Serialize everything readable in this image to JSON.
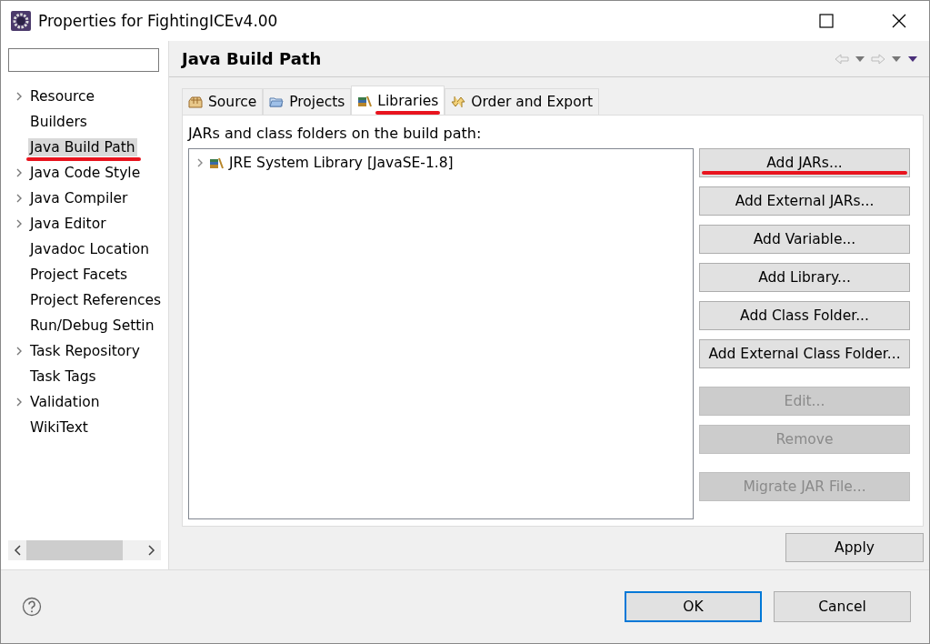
{
  "window": {
    "title": "Properties for FightingICEv4.00"
  },
  "sidebar": {
    "items": [
      {
        "label": "Resource",
        "expandable": true,
        "selected": false,
        "annotated": false
      },
      {
        "label": "Builders",
        "expandable": false,
        "selected": false,
        "annotated": false
      },
      {
        "label": "Java Build Path",
        "expandable": false,
        "selected": true,
        "annotated": true
      },
      {
        "label": "Java Code Style",
        "expandable": true,
        "selected": false,
        "annotated": false
      },
      {
        "label": "Java Compiler",
        "expandable": true,
        "selected": false,
        "annotated": false
      },
      {
        "label": "Java Editor",
        "expandable": true,
        "selected": false,
        "annotated": false
      },
      {
        "label": "Javadoc Location",
        "expandable": false,
        "selected": false,
        "annotated": false
      },
      {
        "label": "Project Facets",
        "expandable": false,
        "selected": false,
        "annotated": false
      },
      {
        "label": "Project References",
        "expandable": false,
        "selected": false,
        "annotated": false
      },
      {
        "label": "Run/Debug Settin",
        "expandable": false,
        "selected": false,
        "annotated": false
      },
      {
        "label": "Task Repository",
        "expandable": true,
        "selected": false,
        "annotated": false
      },
      {
        "label": "Task Tags",
        "expandable": false,
        "selected": false,
        "annotated": false
      },
      {
        "label": "Validation",
        "expandable": true,
        "selected": false,
        "annotated": false
      },
      {
        "label": "WikiText",
        "expandable": false,
        "selected": false,
        "annotated": false
      }
    ]
  },
  "page": {
    "title": "Java Build Path",
    "tabs": [
      {
        "label": "Source",
        "kind": "source",
        "selected": false,
        "annotated": false
      },
      {
        "label": "Projects",
        "kind": "projects",
        "selected": false,
        "annotated": false
      },
      {
        "label": "Libraries",
        "kind": "libraries",
        "selected": true,
        "annotated": true
      },
      {
        "label": "Order and Export",
        "kind": "order",
        "selected": false,
        "annotated": false
      }
    ],
    "list_label": "JARs and class folders on the build path:",
    "tree": [
      {
        "label": "JRE System Library [JavaSE-1.8]",
        "expanded": false
      }
    ],
    "button_groups": [
      [
        {
          "label": "Add JARs...",
          "disabled": false,
          "annotated": true
        },
        {
          "label": "Add External JARs...",
          "disabled": false,
          "annotated": false
        },
        {
          "label": "Add Variable...",
          "disabled": false,
          "annotated": false
        },
        {
          "label": "Add Library...",
          "disabled": false,
          "annotated": false
        },
        {
          "label": "Add Class Folder...",
          "disabled": false,
          "annotated": false
        },
        {
          "label": "Add External Class Folder...",
          "disabled": false,
          "annotated": false
        }
      ],
      [
        {
          "label": "Edit...",
          "disabled": true,
          "annotated": false
        },
        {
          "label": "Remove",
          "disabled": true,
          "annotated": false
        }
      ],
      [
        {
          "label": "Migrate JAR File...",
          "disabled": true,
          "annotated": false
        }
      ]
    ],
    "apply": "Apply"
  },
  "footer": {
    "buttons": [
      {
        "label": "OK",
        "default": true
      },
      {
        "label": "Cancel",
        "default": false
      }
    ]
  }
}
